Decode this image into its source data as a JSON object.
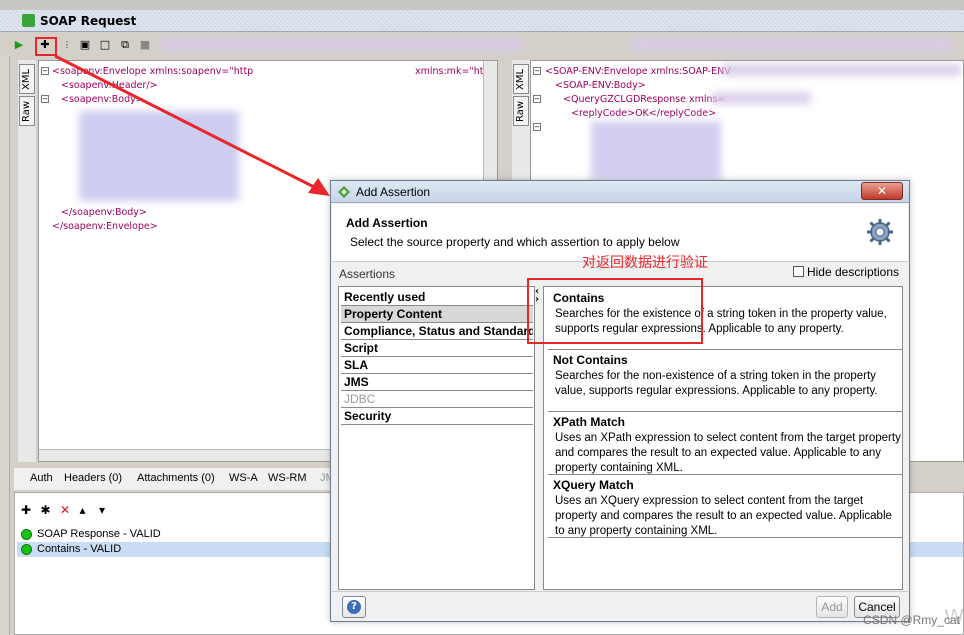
{
  "window": {
    "title": "SOAP Request"
  },
  "left_editor": {
    "tabs": [
      "XML",
      "Raw"
    ],
    "lines": [
      {
        "text": "<soapenv:Envelope xmlns:soapenv=\"http",
        "indent": 0
      },
      {
        "text": "<soapenv:Header/>",
        "indent": 1
      },
      {
        "text": "<soapenv:Body>",
        "indent": 1
      },
      {
        "text": "</soapenv:Body>",
        "indent": 1
      },
      {
        "text": "</soapenv:Envelope>",
        "indent": 0
      }
    ],
    "partial_ns": "xmlns:mk=\"http://r"
  },
  "right_editor": {
    "tabs": [
      "XML",
      "Raw"
    ],
    "lines": [
      {
        "text": "<SOAP-ENV:Envelope xmlns:SOAP-ENV",
        "indent": 0
      },
      {
        "text": "<SOAP-ENV:Body>",
        "indent": 1
      },
      {
        "text": "<QueryGZCLGDResponse xmlns=",
        "indent": 2
      },
      {
        "text": "<replyCode>OK</replyCode>",
        "indent": 3
      }
    ]
  },
  "bottom_tabs": [
    "Auth",
    "Headers (0)",
    "Attachments (0)",
    "WS-A",
    "WS-RM",
    "JM"
  ],
  "assertion_results": [
    {
      "label": "SOAP Response - VALID",
      "selected": false
    },
    {
      "label": "Contains - VALID",
      "selected": true
    }
  ],
  "dialog": {
    "title": "Add Assertion",
    "heading": "Add Assertion",
    "subtitle": "Select the source property and which assertion to apply below",
    "assertions_label": "Assertions",
    "hide_descriptions": "Hide descriptions",
    "categories": [
      {
        "label": "Recently used",
        "selected": false,
        "dim": false
      },
      {
        "label": "Property Content",
        "selected": true,
        "dim": false
      },
      {
        "label": "Compliance, Status and Standards",
        "selected": false,
        "dim": false
      },
      {
        "label": "Script",
        "selected": false,
        "dim": false
      },
      {
        "label": "SLA",
        "selected": false,
        "dim": false
      },
      {
        "label": "JMS",
        "selected": false,
        "dim": false
      },
      {
        "label": "JDBC",
        "selected": false,
        "dim": true
      },
      {
        "label": "Security",
        "selected": false,
        "dim": false
      }
    ],
    "items": [
      {
        "name": "Contains",
        "desc": "Searches for the existence of a string token in the property value, supports regular expressions. Applicable to any property."
      },
      {
        "name": "Not Contains",
        "desc": "Searches for the non-existence of a string token in the property value, supports regular expressions. Applicable to any property."
      },
      {
        "name": "XPath Match",
        "desc": "Uses an XPath expression to select content from the target property and compares the result to an expected value. Applicable to any property containing XML."
      },
      {
        "name": "XQuery Match",
        "desc": "Uses an XQuery expression to select content from the target property and compares the result to an expected value. Applicable to any property containing XML."
      }
    ],
    "add_label": "Add",
    "cancel_label": "Cancel"
  },
  "annotation": {
    "note": "对返回数据进行验证",
    "color": "#e8262c"
  },
  "watermark": "CSDN @Rmy_cat"
}
